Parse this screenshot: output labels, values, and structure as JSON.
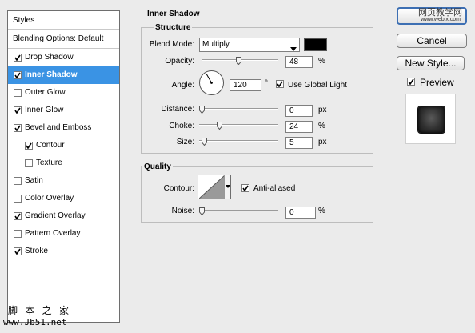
{
  "styles_panel": {
    "header": "Styles",
    "blending_options": "Blending Options: Default",
    "items": [
      {
        "label": "Drop Shadow",
        "checked": true,
        "indent": false
      },
      {
        "label": "Inner Shadow",
        "checked": true,
        "indent": false,
        "selected": true
      },
      {
        "label": "Outer Glow",
        "checked": false,
        "indent": false
      },
      {
        "label": "Inner Glow",
        "checked": true,
        "indent": false
      },
      {
        "label": "Bevel and Emboss",
        "checked": true,
        "indent": false
      },
      {
        "label": "Contour",
        "checked": true,
        "indent": true
      },
      {
        "label": "Texture",
        "checked": false,
        "indent": true
      },
      {
        "label": "Satin",
        "checked": false,
        "indent": false
      },
      {
        "label": "Color Overlay",
        "checked": false,
        "indent": false
      },
      {
        "label": "Gradient Overlay",
        "checked": true,
        "indent": false
      },
      {
        "label": "Pattern Overlay",
        "checked": false,
        "indent": false
      },
      {
        "label": "Stroke",
        "checked": true,
        "indent": false
      }
    ]
  },
  "inner_shadow": {
    "title": "Inner Shadow",
    "structure": {
      "title": "Structure",
      "blend_mode_label": "Blend Mode:",
      "blend_mode_value": "Multiply",
      "shadow_color": "#000000",
      "opacity_label": "Opacity:",
      "opacity_value": "48",
      "opacity_unit": "%",
      "opacity_level": 0.48,
      "angle_label": "Angle:",
      "angle_value": "120",
      "angle_unit": "°",
      "use_global_light_label": "Use Global Light",
      "use_global_light_checked": true,
      "distance_label": "Distance:",
      "distance_value": "0",
      "distance_unit": "px",
      "distance_level": 0.0,
      "choke_label": "Choke:",
      "choke_value": "24",
      "choke_unit": "%",
      "choke_level": 0.24,
      "size_label": "Size:",
      "size_value": "5",
      "size_unit": "px",
      "size_level": 0.03
    },
    "quality": {
      "title": "Quality",
      "contour_label": "Contour:",
      "anti_aliased_label": "Anti-aliased",
      "anti_aliased_checked": true,
      "noise_label": "Noise:",
      "noise_value": "0",
      "noise_unit": "%",
      "noise_level": 0.0
    }
  },
  "buttons": {
    "ok_watermark": "网页教学网",
    "ok_watermark_url": "www.webjx.com",
    "cancel": "Cancel",
    "new_style": "New Style...",
    "preview_label": "Preview",
    "preview_checked": true
  },
  "watermark": {
    "line1": "脚 本 之 家",
    "line2": "www.Jb51.net"
  },
  "colors": {
    "selection": "#3a93e4",
    "panel_bg": "#ebebeb"
  }
}
